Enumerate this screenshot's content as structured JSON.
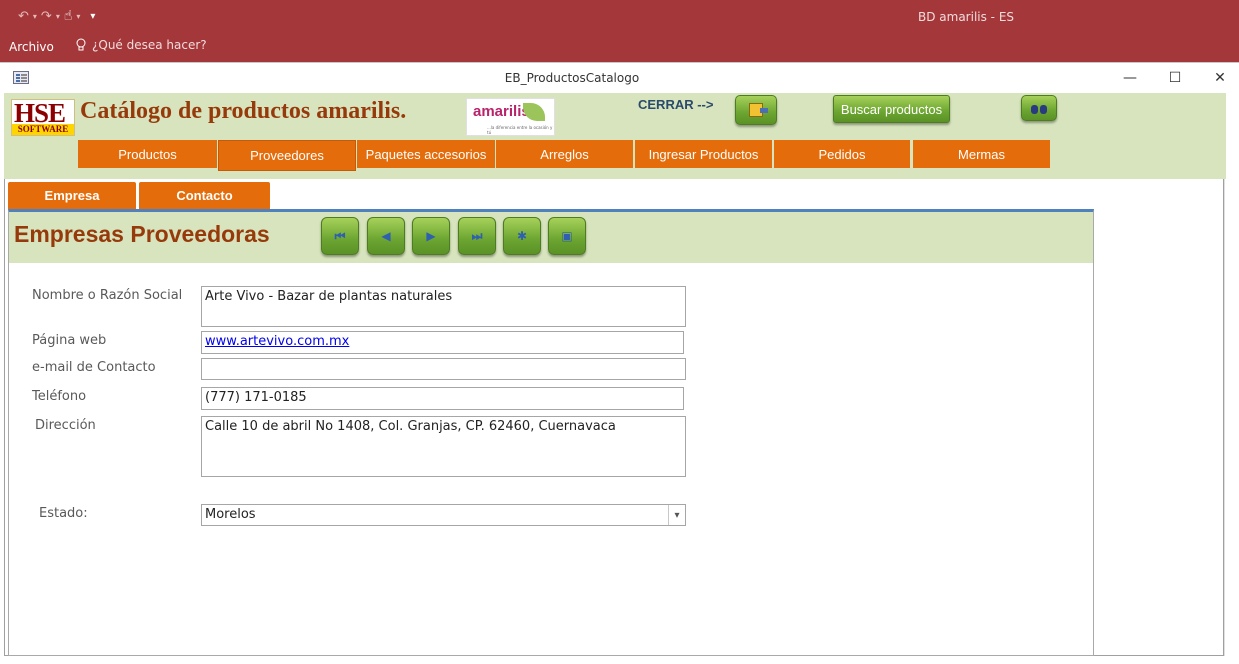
{
  "app": {
    "title": "BD amarilis - ES"
  },
  "ribbon": {
    "file_label": "Archivo",
    "tell_me": "¿Qué desea hacer?"
  },
  "form_window": {
    "title": "EB_ProductosCatalogo",
    "minimize": "—",
    "maximize": "☐",
    "close": "✕"
  },
  "header": {
    "logo_text": "HSE",
    "logo_subtext": "SOFTWARE",
    "title": "Catálogo de productos amarilis.",
    "brand_logo": "amarilis",
    "brand_tagline": "...la diferencia entre la ocasión y tú",
    "close_label": "CERRAR -->",
    "search_button": "Buscar productos"
  },
  "menu_tabs": [
    {
      "label": "Productos"
    },
    {
      "label": "Proveedores"
    },
    {
      "label": "Paquetes accesorios"
    },
    {
      "label": "Arreglos"
    },
    {
      "label": "Ingresar Productos"
    },
    {
      "label": "Pedidos"
    },
    {
      "label": "Mermas"
    }
  ],
  "sub_tabs": [
    {
      "label": "Empresa"
    },
    {
      "label": "Contacto"
    }
  ],
  "panel": {
    "title": "Empresas Proveedoras",
    "nav_icons": [
      "first-record-icon",
      "previous-record-icon",
      "next-record-icon",
      "last-record-icon",
      "new-record-icon",
      "save-record-icon"
    ]
  },
  "fields": {
    "razon_social": {
      "label": "Nombre o Razón Social",
      "value": "Arte Vivo - Bazar de plantas naturales"
    },
    "web": {
      "label": "Página web",
      "value": "www.artevivo.com.mx"
    },
    "email": {
      "label": "e-mail de Contacto",
      "value": ""
    },
    "telefono": {
      "label": "Teléfono",
      "value": "(777) 171-0185"
    },
    "direccion": {
      "label": "Dirección",
      "value": "Calle 10 de abril No 1408, Col. Granjas, CP. 62460, Cuernavaca"
    },
    "estado": {
      "label": "Estado:",
      "value": "Morelos"
    }
  },
  "colors": {
    "titlebar": "#a4373a",
    "header_green": "#d7e4bd",
    "tab_orange": "#e46c0a",
    "title_brown": "#973a0b",
    "accent_blue": "#4f81bd"
  }
}
